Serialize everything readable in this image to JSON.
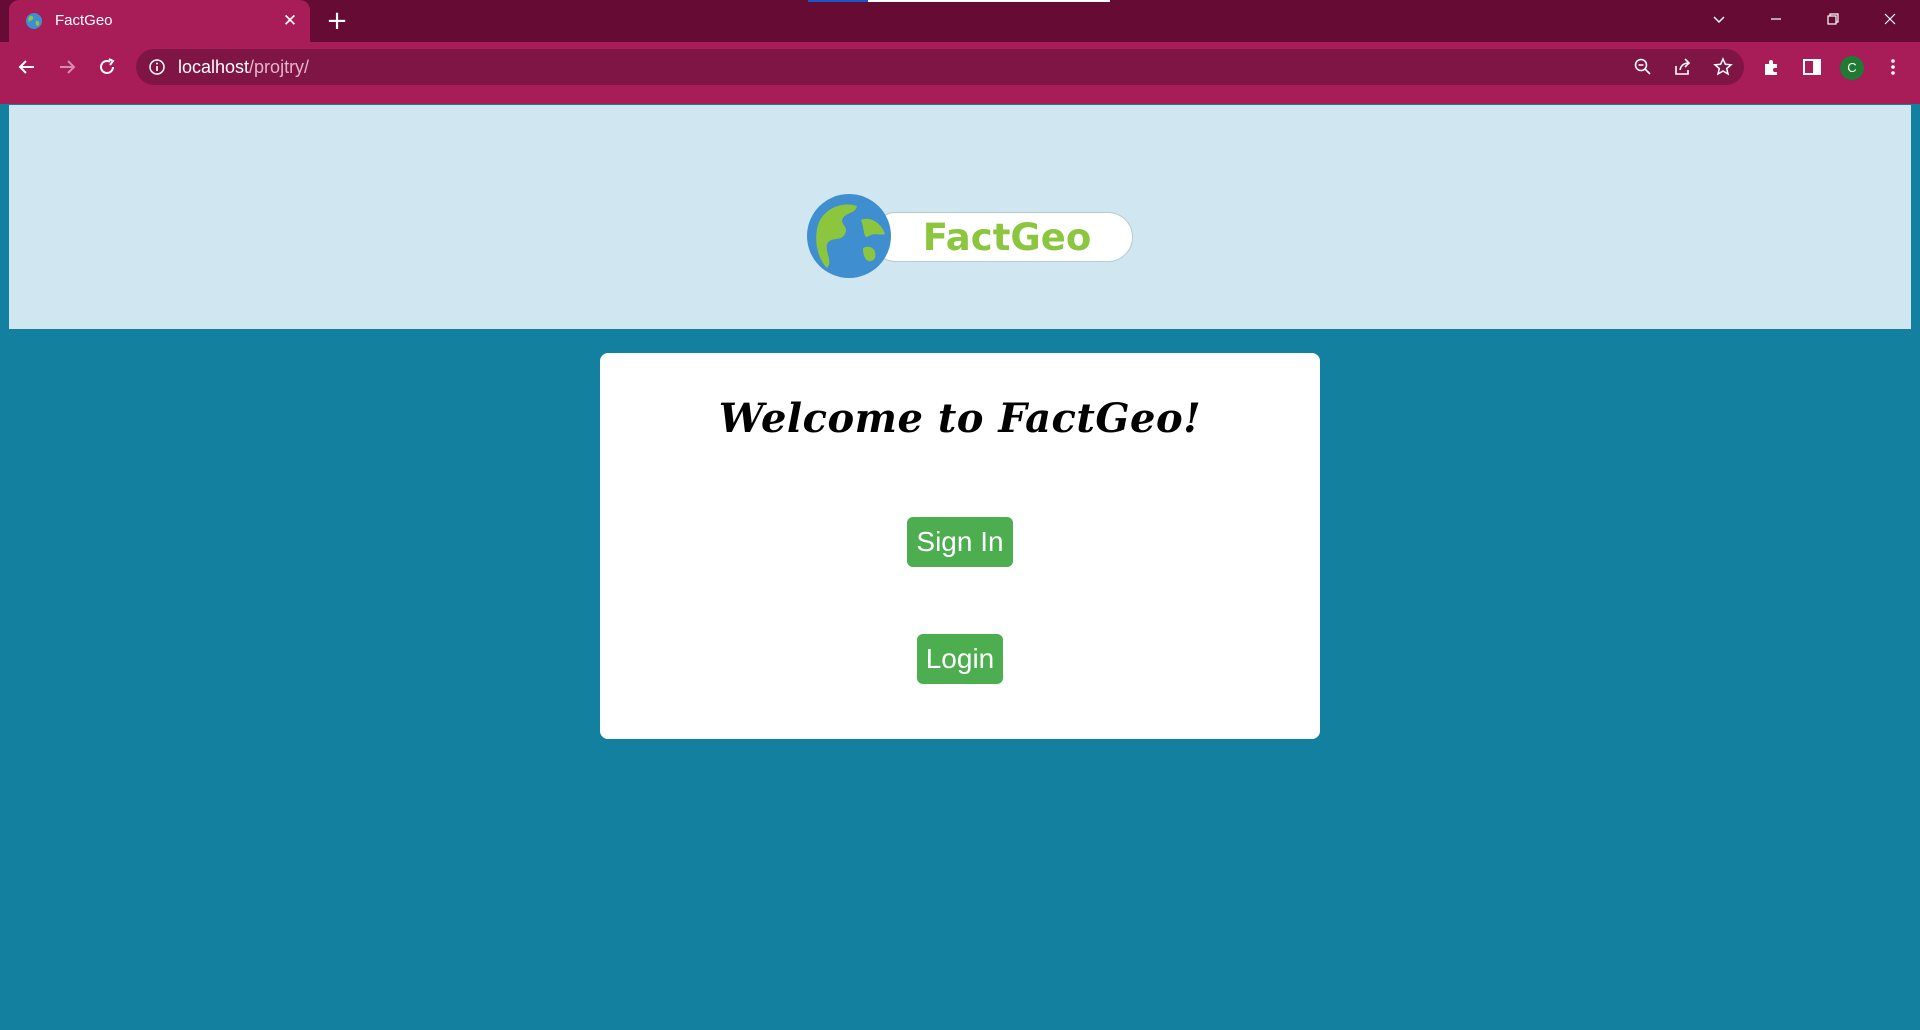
{
  "browser": {
    "tab": {
      "title": "FactGeo",
      "close_icon": "close-icon"
    },
    "new_tab_icon": "plus-icon",
    "window_controls": [
      "chevron-down-icon",
      "minimize-icon",
      "restore-icon",
      "close-icon"
    ],
    "address": {
      "host": "localhost",
      "path": "/projtry/"
    },
    "profile_initial": "C",
    "colors": {
      "titlebar": "#660b34",
      "toolbar": "#a81c57",
      "omnibox": "#7f1544"
    }
  },
  "header": {
    "logo_text": "FactGeo",
    "colors": {
      "band": "#d0e6f0",
      "logo_text": "#8cc63f"
    }
  },
  "main": {
    "welcome_heading": "Welcome to FactGeo!",
    "signin_label": "Sign In",
    "login_label": "Login",
    "colors": {
      "background": "#13809f",
      "button": "#4cae4f"
    }
  }
}
